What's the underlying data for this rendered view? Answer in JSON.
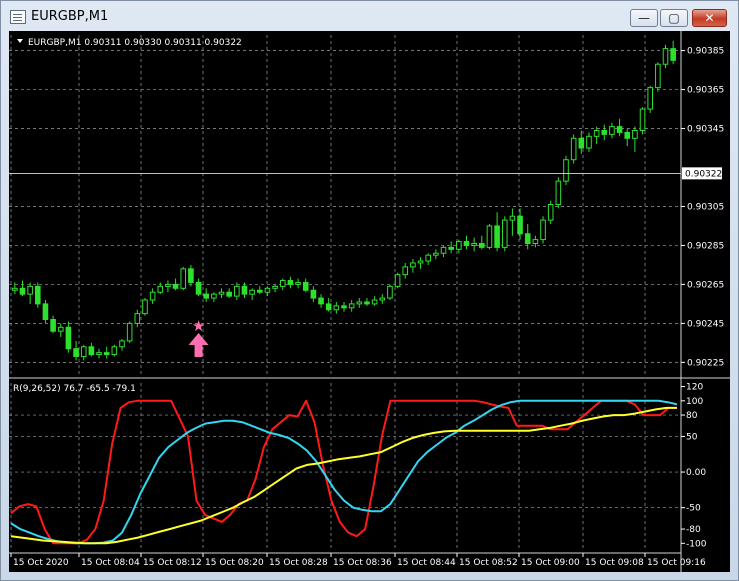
{
  "window": {
    "title": "EURGBP,M1",
    "buttons": {
      "minimize": "—",
      "maximize": "▢",
      "close": "✕"
    }
  },
  "main_chart": {
    "header": "EURGBP,M1  0.90311 0.90330 0.90311 0.90322",
    "price_labels": [
      "0.90385",
      "0.90365",
      "0.90345",
      "0.90305",
      "0.90285",
      "0.90265",
      "0.90245",
      "0.90225"
    ],
    "price_levels": [
      0.90385,
      0.90365,
      0.90345,
      0.90305,
      0.90285,
      0.90265,
      0.90245,
      0.90225
    ],
    "current_price": "0.90322",
    "current_price_value": 0.90322,
    "range": [
      0.90218,
      0.90393
    ],
    "candles": [
      [
        0.90262,
        0.90266,
        0.9026,
        0.90263
      ],
      [
        0.90263,
        0.90267,
        0.90259,
        0.9026
      ],
      [
        0.9026,
        0.90266,
        0.90255,
        0.90264
      ],
      [
        0.90264,
        0.90266,
        0.90253,
        0.90255
      ],
      [
        0.90255,
        0.90257,
        0.90245,
        0.90247
      ],
      [
        0.90247,
        0.90249,
        0.9024,
        0.90241
      ],
      [
        0.90241,
        0.90245,
        0.90238,
        0.90243
      ],
      [
        0.90243,
        0.90246,
        0.9023,
        0.90232
      ],
      [
        0.90232,
        0.90236,
        0.90226,
        0.90228
      ],
      [
        0.90228,
        0.90234,
        0.90226,
        0.90233
      ],
      [
        0.90233,
        0.90235,
        0.90228,
        0.90229
      ],
      [
        0.90229,
        0.90232,
        0.90227,
        0.9023
      ],
      [
        0.9023,
        0.90233,
        0.90227,
        0.90229
      ],
      [
        0.90229,
        0.90234,
        0.90228,
        0.90233
      ],
      [
        0.90233,
        0.90237,
        0.90231,
        0.90236
      ],
      [
        0.90236,
        0.90246,
        0.90235,
        0.90245
      ],
      [
        0.90245,
        0.90252,
        0.90243,
        0.9025
      ],
      [
        0.9025,
        0.90258,
        0.90249,
        0.90257
      ],
      [
        0.90257,
        0.90263,
        0.90255,
        0.90261
      ],
      [
        0.90261,
        0.90266,
        0.9026,
        0.90264
      ],
      [
        0.90264,
        0.90267,
        0.90261,
        0.90265
      ],
      [
        0.90265,
        0.90268,
        0.90262,
        0.90263
      ],
      [
        0.90263,
        0.90274,
        0.90262,
        0.90273
      ],
      [
        0.90273,
        0.90275,
        0.90264,
        0.90266
      ],
      [
        0.90266,
        0.90268,
        0.90259,
        0.9026
      ],
      [
        0.9026,
        0.90263,
        0.90256,
        0.90258
      ],
      [
        0.90258,
        0.90261,
        0.90256,
        0.9026
      ],
      [
        0.9026,
        0.90263,
        0.90258,
        0.90261
      ],
      [
        0.90261,
        0.90263,
        0.90258,
        0.90259
      ],
      [
        0.90259,
        0.90266,
        0.90257,
        0.90264
      ],
      [
        0.90264,
        0.90266,
        0.90258,
        0.9026
      ],
      [
        0.9026,
        0.90263,
        0.90257,
        0.90262
      ],
      [
        0.90262,
        0.90264,
        0.9026,
        0.90261
      ],
      [
        0.90261,
        0.90264,
        0.90259,
        0.90263
      ],
      [
        0.90263,
        0.90265,
        0.90261,
        0.90264
      ],
      [
        0.90264,
        0.90268,
        0.90262,
        0.90267
      ],
      [
        0.90267,
        0.90269,
        0.90263,
        0.90265
      ],
      [
        0.90265,
        0.90268,
        0.90263,
        0.90266
      ],
      [
        0.90266,
        0.90268,
        0.90261,
        0.90262
      ],
      [
        0.90262,
        0.90264,
        0.90256,
        0.90258
      ],
      [
        0.90258,
        0.9026,
        0.90253,
        0.90255
      ],
      [
        0.90255,
        0.90258,
        0.90251,
        0.90252
      ],
      [
        0.90252,
        0.90256,
        0.9025,
        0.90254
      ],
      [
        0.90254,
        0.90256,
        0.90251,
        0.90253
      ],
      [
        0.90253,
        0.90257,
        0.90251,
        0.90255
      ],
      [
        0.90255,
        0.90258,
        0.90253,
        0.90256
      ],
      [
        0.90256,
        0.90258,
        0.90254,
        0.90255
      ],
      [
        0.90255,
        0.90259,
        0.90254,
        0.90257
      ],
      [
        0.90257,
        0.9026,
        0.90255,
        0.90258
      ],
      [
        0.90258,
        0.90265,
        0.90257,
        0.90264
      ],
      [
        0.90264,
        0.90271,
        0.90263,
        0.9027
      ],
      [
        0.9027,
        0.90276,
        0.90268,
        0.90274
      ],
      [
        0.90274,
        0.90278,
        0.90271,
        0.90276
      ],
      [
        0.90276,
        0.90279,
        0.90273,
        0.90277
      ],
      [
        0.90277,
        0.90281,
        0.90275,
        0.9028
      ],
      [
        0.9028,
        0.90283,
        0.90278,
        0.90281
      ],
      [
        0.90281,
        0.90285,
        0.90279,
        0.90284
      ],
      [
        0.90284,
        0.90287,
        0.90281,
        0.90283
      ],
      [
        0.90283,
        0.90288,
        0.90281,
        0.90287
      ],
      [
        0.90287,
        0.9029,
        0.90283,
        0.90285
      ],
      [
        0.90285,
        0.90289,
        0.90282,
        0.90286
      ],
      [
        0.90286,
        0.9029,
        0.90283,
        0.90284
      ],
      [
        0.90284,
        0.90296,
        0.90283,
        0.90295
      ],
      [
        0.90295,
        0.90302,
        0.90282,
        0.90284
      ],
      [
        0.90284,
        0.903,
        0.90282,
        0.90298
      ],
      [
        0.90298,
        0.90304,
        0.9029,
        0.903
      ],
      [
        0.903,
        0.90304,
        0.90288,
        0.90291
      ],
      [
        0.90291,
        0.90296,
        0.90283,
        0.90286
      ],
      [
        0.90286,
        0.9029,
        0.90284,
        0.90288
      ],
      [
        0.90288,
        0.903,
        0.90286,
        0.90298
      ],
      [
        0.90298,
        0.90308,
        0.90296,
        0.90306
      ],
      [
        0.90306,
        0.9032,
        0.90304,
        0.90318
      ],
      [
        0.90318,
        0.90331,
        0.90316,
        0.90329
      ],
      [
        0.90329,
        0.90342,
        0.90327,
        0.9034
      ],
      [
        0.9034,
        0.90344,
        0.90332,
        0.90335
      ],
      [
        0.90335,
        0.90343,
        0.90333,
        0.90341
      ],
      [
        0.90341,
        0.90346,
        0.90337,
        0.90344
      ],
      [
        0.90344,
        0.90347,
        0.90339,
        0.90342
      ],
      [
        0.90342,
        0.90348,
        0.9034,
        0.90346
      ],
      [
        0.90346,
        0.9035,
        0.90341,
        0.90343
      ],
      [
        0.90343,
        0.90345,
        0.90336,
        0.9034
      ],
      [
        0.9034,
        0.90346,
        0.90333,
        0.90344
      ],
      [
        0.90344,
        0.90356,
        0.90342,
        0.90355
      ],
      [
        0.90355,
        0.90367,
        0.90353,
        0.90366
      ],
      [
        0.90366,
        0.90379,
        0.90364,
        0.90378
      ],
      [
        0.90378,
        0.90388,
        0.90376,
        0.90386
      ],
      [
        0.90386,
        0.9039,
        0.90378,
        0.9038
      ]
    ],
    "signal": {
      "marker": "★",
      "arrow": "up",
      "color": "#ff6fb0",
      "bar_index": 24
    }
  },
  "indicator": {
    "header": "R(9,26,52) 76.7 -65.5 -79.1",
    "scale_labels": [
      "120",
      "100",
      "80",
      "50",
      "0.00",
      "-50",
      "-80",
      "-100"
    ],
    "scale_levels": [
      120,
      100,
      80,
      50,
      0,
      -50,
      -80,
      -100
    ],
    "range": [
      -108,
      125
    ],
    "series": [
      {
        "color": "#ff1a1a",
        "values": [
          -58,
          -48,
          -45,
          -48,
          -80,
          -100,
          -100,
          -100,
          -100,
          -95,
          -80,
          -40,
          40,
          90,
          98,
          100,
          100,
          100,
          100,
          100,
          75,
          50,
          -40,
          -60,
          -65,
          -70,
          -60,
          -45,
          -40,
          -10,
          35,
          60,
          70,
          80,
          78,
          100,
          70,
          10,
          -40,
          -70,
          -85,
          -90,
          -80,
          -20,
          50,
          100,
          100,
          100,
          100,
          100,
          100,
          100,
          100,
          100,
          100,
          100,
          98,
          95,
          92,
          90,
          65,
          65,
          65,
          65,
          60,
          60,
          60,
          70,
          80,
          90,
          100,
          100,
          100,
          100,
          95,
          80,
          80,
          80,
          90,
          90
        ]
      },
      {
        "color": "#33d6f0",
        "values": [
          -72,
          -80,
          -85,
          -90,
          -94,
          -97,
          -99,
          -100,
          -100,
          -100,
          -99,
          -96,
          -85,
          -60,
          -30,
          -5,
          20,
          35,
          45,
          55,
          62,
          68,
          70,
          72,
          72,
          70,
          65,
          60,
          55,
          52,
          48,
          40,
          30,
          15,
          -5,
          -25,
          -40,
          -50,
          -53,
          -55,
          -55,
          -45,
          -25,
          -5,
          15,
          28,
          38,
          48,
          55,
          65,
          72,
          80,
          88,
          94,
          98,
          100,
          100,
          100,
          100,
          100,
          100,
          100,
          100,
          100,
          100,
          100,
          100,
          100,
          100,
          100,
          100,
          98,
          95
        ]
      },
      {
        "color": "#ffff2a",
        "values": [
          -90,
          -92,
          -94,
          -96,
          -97,
          -98,
          -99,
          -100,
          -100,
          -100,
          -98,
          -95,
          -92,
          -88,
          -84,
          -80,
          -76,
          -72,
          -68,
          -62,
          -56,
          -50,
          -42,
          -35,
          -25,
          -15,
          -5,
          5,
          10,
          12,
          15,
          18,
          20,
          22,
          25,
          28,
          35,
          42,
          48,
          52,
          55,
          57,
          58,
          58,
          58,
          58,
          58,
          58,
          58,
          58,
          60,
          62,
          65,
          68,
          72,
          75,
          78,
          80,
          80,
          82,
          85,
          88,
          90,
          90
        ]
      }
    ]
  },
  "time_axis": {
    "labels": [
      "15 Oct 2020",
      "15 Oct 08:04",
      "15 Oct 08:12",
      "15 Oct 08:20",
      "15 Oct 08:28",
      "15 Oct 08:36",
      "15 Oct 08:44",
      "15 Oct 08:52",
      "15 Oct 09:00",
      "15 Oct 09:08",
      "15 Oct 09:16"
    ]
  },
  "colors": {
    "background": "#000000",
    "grid": "#9aa0a6",
    "axis_text": "#ffffff",
    "candle": "#2ee02e",
    "price_line": "#ffffff"
  }
}
